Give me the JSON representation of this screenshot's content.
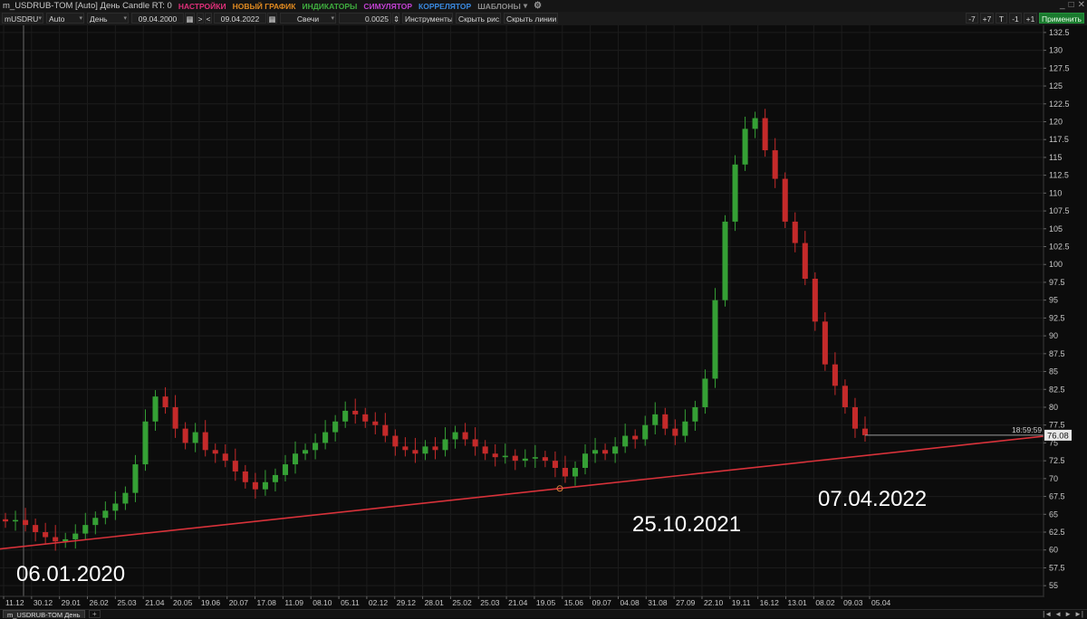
{
  "window": {
    "title": "m_USDRUB-TOM [Auto] День Candle RT: 0",
    "menu": [
      {
        "label": "НАСТРОЙКИ",
        "color": "#e0307a"
      },
      {
        "label": "НОВЫЙ ГРАФИК",
        "color": "#e08a20"
      },
      {
        "label": "ИНДИКАТОРЫ",
        "color": "#3fae3f"
      },
      {
        "label": "СИМУЛЯТОР",
        "color": "#c040d0"
      },
      {
        "label": "КОРРЕЛЯТОР",
        "color": "#3a8ae0"
      },
      {
        "label": "ШАБЛОНЫ",
        "color": "#8c8c8c"
      }
    ],
    "controls": [
      "_",
      "□",
      "✕"
    ]
  },
  "toolbar": {
    "instrument": "mUSDRU",
    "mode": "Auto",
    "period": "День",
    "date_from": "09.04.2000",
    "date_to": "09.04.2022",
    "nav_right": ">",
    "nav_left": "<",
    "chart_type": "Свечи",
    "step": "0.0025",
    "instruments_btn": "Инструменты",
    "hide_drawings": "Скрыть рис.",
    "hide_lines": "Скрыть линии",
    "minus7": "-7",
    "plus7": "+7",
    "t_btn": "T",
    "minus1": "-1",
    "plus1": "+1",
    "apply": "Применить"
  },
  "bottom": {
    "tab_label": "m_USDRUB-TOM День",
    "add_tab": "+",
    "nav_icons": [
      "|◄",
      "◄",
      "►",
      "►|"
    ]
  },
  "chart_data": {
    "type": "candlestick",
    "title": "",
    "xlabel": "",
    "ylabel": "",
    "ylim": [
      53.5,
      133.5
    ],
    "y_ticks": [
      55,
      57.5,
      60,
      62.5,
      65,
      67.5,
      70,
      72.5,
      75,
      77.5,
      80,
      82.5,
      85,
      87.5,
      90,
      92.5,
      95,
      97.5,
      100,
      102.5,
      105,
      107.5,
      110,
      112.5,
      115,
      117.5,
      120,
      122.5,
      125,
      127.5,
      130,
      132.5
    ],
    "x_ticks": [
      "11.12",
      "30.12",
      "29.01",
      "26.02",
      "25.03",
      "21.04",
      "20.05",
      "19.06",
      "20.07",
      "17.08",
      "11.09",
      "08.10",
      "05.11",
      "02.12",
      "29.12",
      "28.01",
      "25.02",
      "25.03",
      "21.04",
      "19.05",
      "15.06",
      "09.07",
      "04.08",
      "31.08",
      "27.09",
      "22.10",
      "19.11",
      "16.12",
      "13.01",
      "08.02",
      "09.03",
      "05.04"
    ],
    "colors": {
      "up": "#35a035",
      "down": "#c42a2a",
      "trendline": "#d8323a",
      "grid": "#1c1c1c",
      "price_line": "#9a9a9a"
    },
    "last_price": "76.08",
    "countdown": "18:59:59",
    "trendline": {
      "from": "11.12",
      "to": "05.04",
      "y_start": 60.2,
      "y_end": 73.3
    },
    "annotations": [
      {
        "text": "06.01.2020",
        "anchor": "01.2020"
      },
      {
        "text": "25.10.2021",
        "anchor": "10.2021"
      },
      {
        "text": "07.04.2022",
        "anchor": "04.2022"
      }
    ],
    "series": [
      {
        "segment": "Dec 2019 – Feb 2020",
        "close": [
          64,
          64.2,
          63.5,
          62.5,
          61.8,
          61.2,
          61.5,
          62.3,
          63.5,
          64.5,
          65.5,
          66.5
        ]
      },
      {
        "segment": "Mar 2020 spike",
        "close": [
          68,
          72,
          78,
          81.5,
          80,
          77,
          75,
          76.5,
          74
        ]
      },
      {
        "segment": "Apr – Oct 2020",
        "close": [
          73.5,
          72.5,
          71,
          69.5,
          68.5,
          69.5,
          70.5,
          72,
          73.5,
          74,
          75,
          76.5,
          78,
          79.5,
          79,
          78
        ]
      },
      {
        "segment": "Nov 2020 – Sep 2021",
        "close": [
          77.5,
          76,
          74.5,
          74,
          73.5,
          74.5,
          74,
          75.5,
          76.5,
          75.5,
          74.5,
          73.5,
          73,
          73.2,
          72.5,
          72.8,
          73,
          72.5,
          71.5,
          70.3
        ]
      },
      {
        "segment": "Oct 2021 – Feb 2022",
        "close": [
          71.5,
          73.5,
          74,
          73.5,
          74.5,
          76,
          75.5,
          77.5,
          79,
          77,
          76,
          78,
          80
        ]
      },
      {
        "segment": "Mar 2022 spike",
        "close": [
          84,
          95,
          106,
          114,
          119,
          120.5,
          116,
          112,
          106,
          103,
          98,
          92,
          86,
          83,
          80
        ]
      },
      {
        "segment": "Apr 2022",
        "close": [
          77,
          76.08
        ]
      }
    ]
  }
}
